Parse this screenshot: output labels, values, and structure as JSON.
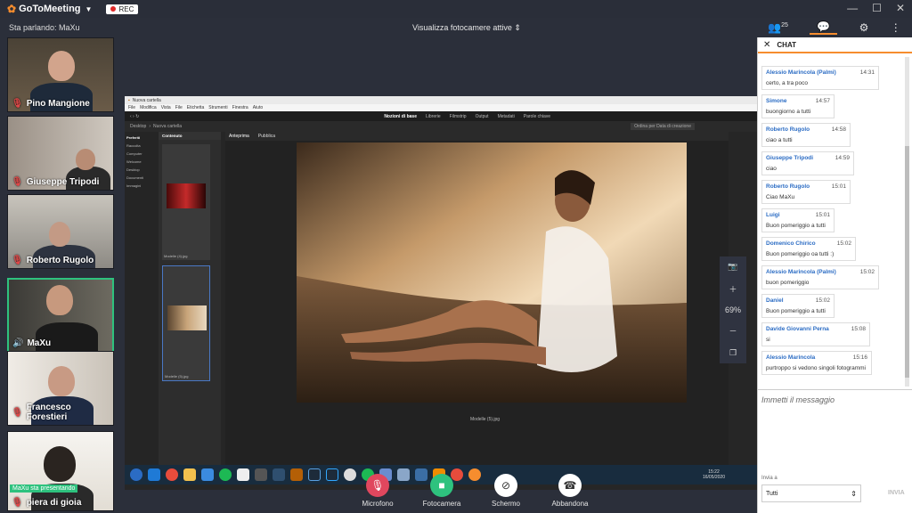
{
  "app": {
    "logo": "GoToMeeting",
    "rec": "REC"
  },
  "window_controls": {
    "min": "—",
    "max": "☐",
    "close": "✕"
  },
  "subbar": {
    "speaking": "Sta parlando: MaXu",
    "cameras": "Visualizza fotocamere attive"
  },
  "top_icons": {
    "attendees_count": "25"
  },
  "participants": [
    {
      "name": "Pino Mangione",
      "muted": true
    },
    {
      "name": "Giuseppe Tripodi",
      "muted": true
    },
    {
      "name": "Roberto Rugolo",
      "muted": true
    },
    {
      "name": "MaXu",
      "muted": false
    },
    {
      "name": "Francesco Forestieri",
      "muted": true
    },
    {
      "name": "piera di gioia",
      "muted": true,
      "presenting": "MaXu sta presentando"
    }
  ],
  "shared_app": {
    "window_title": "Nuova cartella",
    "menu": [
      "File",
      "Modifica",
      "Vista",
      "File",
      "Etichetta",
      "Strumenti",
      "Finestra",
      "Aiuto"
    ],
    "tabs": [
      "Nozioni di base",
      "Librerie",
      "Filmstrip",
      "Output",
      "Metadati",
      "Parole chiave"
    ],
    "path": [
      "Desktop",
      "Nuova cartella"
    ],
    "sort": "Ordina per Data di creazione",
    "left_pane": {
      "title": "Preferiti",
      "items": [
        "Raccolta",
        "Computer",
        "Welcome",
        "Desktop",
        "Documenti",
        "Immagini"
      ]
    },
    "content_pane": {
      "title": "Contenuto",
      "thumb1": "Modelle (4).jpg",
      "thumb2": "Modelle (5).jpg"
    },
    "preview_tabs": [
      "Anteprima",
      "Pubblica"
    ],
    "photo_caption": "Modelle (5).jpg",
    "zoom": "69%",
    "bottom_tabs": [
      "Metadati",
      "Parole chiave"
    ],
    "clock": {
      "time": "15:22",
      "date": "16/05/2020"
    }
  },
  "controls": [
    {
      "label": "Microfono",
      "color": "#e0475e"
    },
    {
      "label": "Fotocamera",
      "color": "#2ec27e"
    },
    {
      "label": "Schermo",
      "color": "#ffffff"
    },
    {
      "label": "Abbandona",
      "color": "#ffffff"
    }
  ],
  "chat": {
    "title": "CHAT",
    "messages": [
      {
        "from": "Alessio Marincola (Palmi)",
        "time": "14:31",
        "text": "certo, a tra poco"
      },
      {
        "from": "Simone",
        "time": "14:57",
        "text": "buongiorno a tutti"
      },
      {
        "from": "Roberto Rugolo",
        "time": "14:58",
        "text": "ciao a tutti"
      },
      {
        "from": "Giuseppe Tripodi",
        "time": "14:59",
        "text": "ciao"
      },
      {
        "from": "Roberto Rugolo",
        "time": "15:01",
        "text": "Ciao MaXu"
      },
      {
        "from": "Luigi",
        "time": "15:01",
        "text": "Buon pomeriggio a tutti"
      },
      {
        "from": "Domenico Chirico",
        "time": "15:02",
        "text": "Buon pomeriggio oa tutti :)"
      },
      {
        "from": "Alessio Marincola (Palmi)",
        "time": "15:02",
        "text": "buon pomeriggio"
      },
      {
        "from": "Daniel",
        "time": "15:02",
        "text": "Buon pomeriggio a tutti"
      },
      {
        "from": "Davide Giovanni Perna",
        "time": "15:08",
        "text": "si"
      },
      {
        "from": "Alessio Marincola",
        "time": "15:16",
        "text": "purtroppo si vedono singoli fotogrammi"
      }
    ],
    "input_placeholder": "Immetti il messaggio",
    "send_to_label": "Invia a",
    "send_to_value": "Tutti",
    "send_button": "INVIA"
  }
}
